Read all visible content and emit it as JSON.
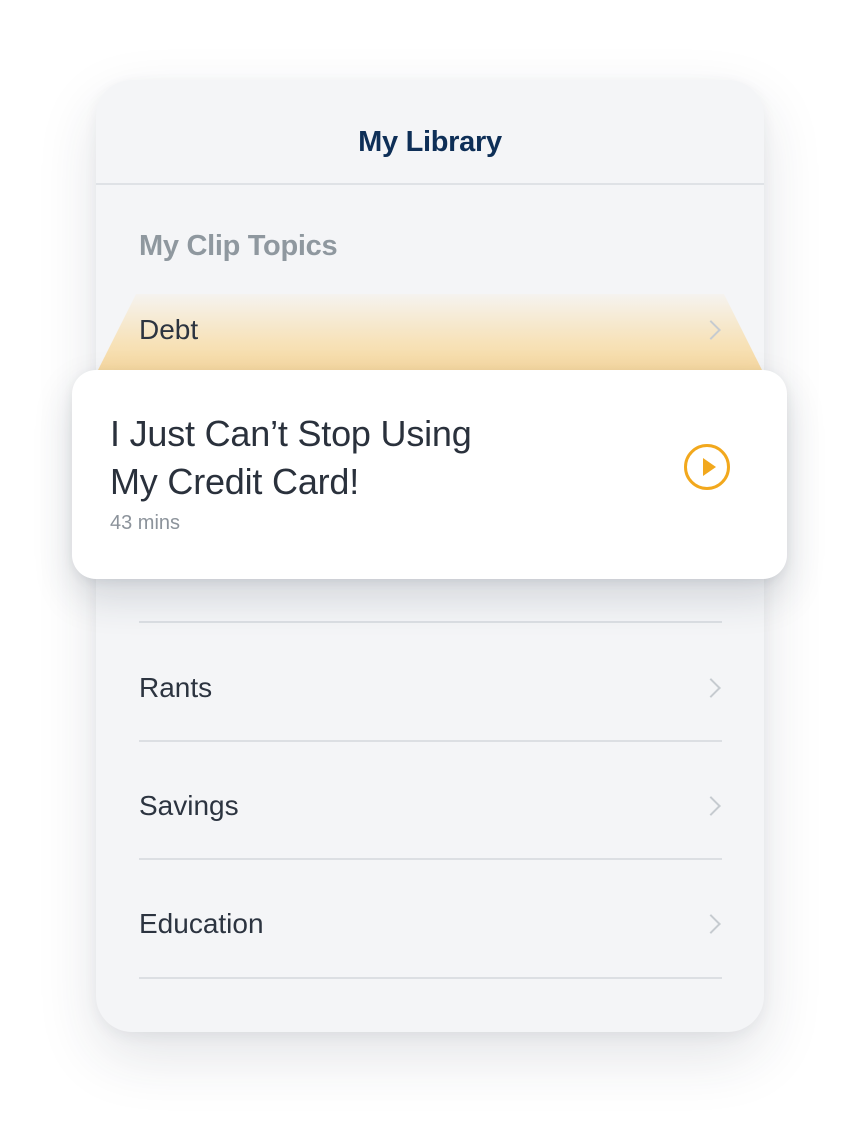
{
  "header": {
    "title": "My Library"
  },
  "section": {
    "title": "My Clip Topics"
  },
  "topics": [
    {
      "label": "Debt"
    },
    {
      "label": "Rants"
    },
    {
      "label": "Savings"
    },
    {
      "label": "Education"
    }
  ],
  "clip_card": {
    "title_line_1": "I Just Can’t Stop Using",
    "title_line_2": "My Credit Card!",
    "duration": "43 mins",
    "play_icon": "play-circle-icon"
  },
  "colors": {
    "title": "#0e2f57",
    "section_title": "#8f989f",
    "accent": "#f2a81d",
    "highlight": "#f7d698",
    "background": "#f4f5f7"
  }
}
